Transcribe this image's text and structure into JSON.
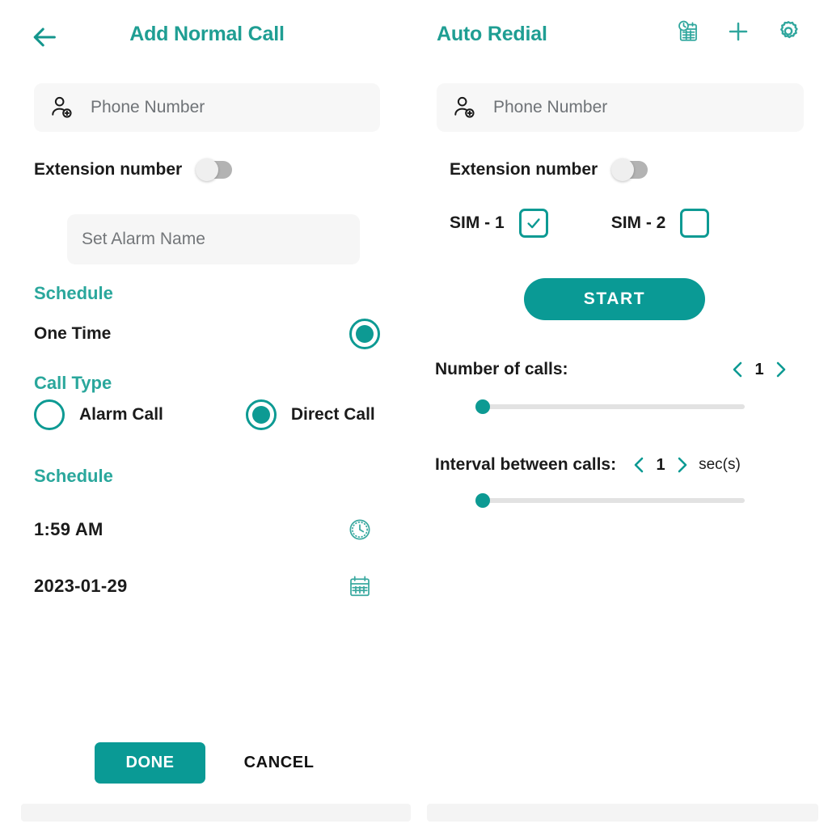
{
  "theme": {
    "accent": "#0d9a93",
    "title_color": "#1f9e93",
    "section_color": "#2aa79c",
    "text_color": "#1b1b1b",
    "placeholder_color": "#6f7377",
    "field_bg": "#f7f7f7",
    "track_color": "#e2e2e2"
  },
  "left_panel": {
    "header": {
      "back_icon": "arrow-left-icon",
      "title": "Add Normal Call"
    },
    "phone_input": {
      "icon": "person-add-icon",
      "placeholder": "Phone Number",
      "value": ""
    },
    "extension": {
      "label": "Extension number",
      "toggle_state": "off"
    },
    "alarm_name": {
      "placeholder": "Set Alarm Name",
      "value": ""
    },
    "schedule_section": {
      "heading": "Schedule",
      "option_label": "One Time",
      "selected": true
    },
    "call_type_section": {
      "heading": "Call Type",
      "options": [
        {
          "label": "Alarm Call",
          "selected": false
        },
        {
          "label": "Direct Call",
          "selected": true
        }
      ]
    },
    "schedule_values_section": {
      "heading": "Schedule",
      "time": "1:59 AM",
      "time_icon": "clock-icon",
      "date": "2023-01-29",
      "date_icon": "calendar-icon"
    },
    "footer": {
      "done_label": "DONE",
      "cancel_label": "CANCEL"
    }
  },
  "right_panel": {
    "header": {
      "title": "Auto Redial",
      "icons": [
        "schedule-history-icon",
        "plus-icon",
        "gear-icon"
      ]
    },
    "phone_input": {
      "icon": "person-add-icon",
      "placeholder": "Phone Number",
      "value": ""
    },
    "extension": {
      "label": "Extension number",
      "toggle_state": "off"
    },
    "sim_options": [
      {
        "label": "SIM - 1",
        "checked": true
      },
      {
        "label": "SIM - 2",
        "checked": false
      }
    ],
    "start_button": {
      "label": "START"
    },
    "number_of_calls": {
      "label": "Number of calls:",
      "value": "1",
      "prev_icon": "chevron-left-icon",
      "next_icon": "chevron-right-icon",
      "slider_percent": 0
    },
    "interval_between_calls": {
      "label": "Interval between calls:",
      "value": "1",
      "unit": "sec(s)",
      "prev_icon": "chevron-left-icon",
      "next_icon": "chevron-right-icon",
      "slider_percent": 0
    }
  }
}
